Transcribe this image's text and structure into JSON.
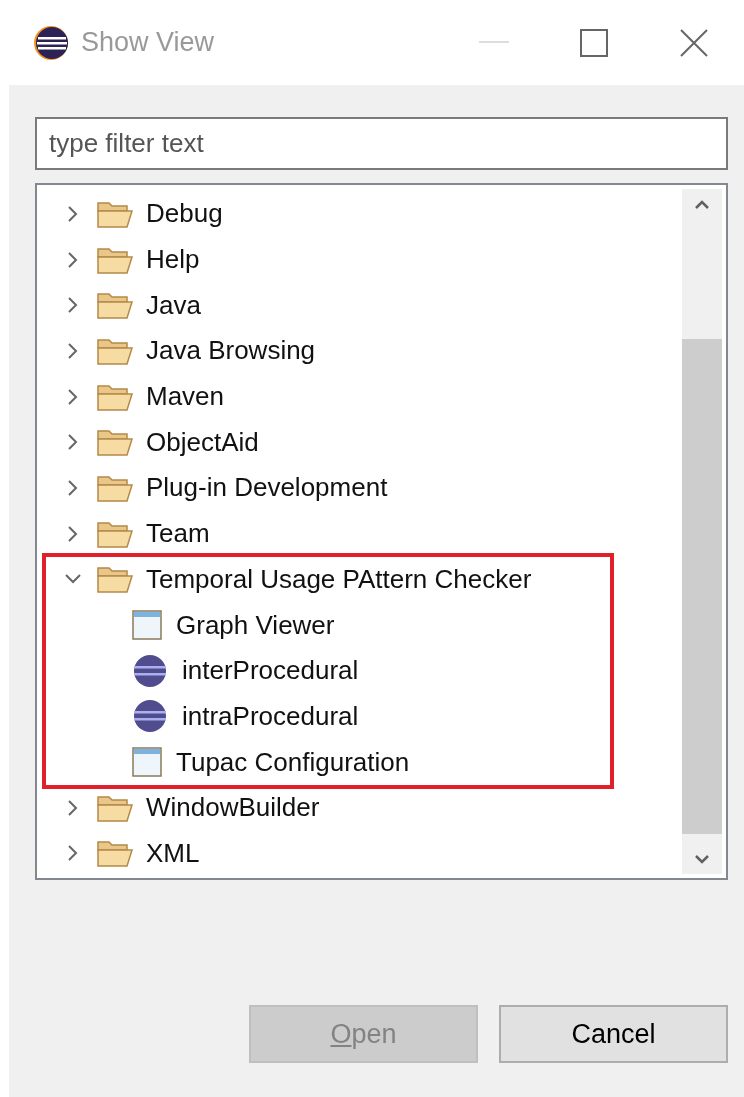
{
  "window": {
    "title": "Show View",
    "active": false
  },
  "filter": {
    "placeholder": "type filter text"
  },
  "tree": [
    {
      "label": "Debug",
      "expanded": false,
      "highlighted": false
    },
    {
      "label": "Help",
      "expanded": false,
      "highlighted": false
    },
    {
      "label": "Java",
      "expanded": false,
      "highlighted": false
    },
    {
      "label": "Java Browsing",
      "expanded": false,
      "highlighted": false
    },
    {
      "label": "Maven",
      "expanded": false,
      "highlighted": false
    },
    {
      "label": "ObjectAid",
      "expanded": false,
      "highlighted": false
    },
    {
      "label": "Plug-in Development",
      "expanded": false,
      "highlighted": false
    },
    {
      "label": "Team",
      "expanded": false,
      "highlighted": false
    },
    {
      "label": "Temporal Usage PAttern Checker",
      "expanded": true,
      "highlighted": true,
      "children": [
        {
          "label": "Graph Viewer",
          "kind": "view"
        },
        {
          "label": "interProcedural",
          "kind": "eclipse"
        },
        {
          "label": "intraProcedural",
          "kind": "eclipse"
        },
        {
          "label": "Tupac Configuration",
          "kind": "view"
        }
      ]
    },
    {
      "label": "WindowBuilder",
      "expanded": false,
      "highlighted": false
    },
    {
      "label": "XML",
      "expanded": false,
      "highlighted": false
    }
  ],
  "buttons": [
    {
      "label": "Open",
      "disabled": true,
      "mnemonic": true
    },
    {
      "label": "Cancel",
      "disabled": false,
      "mnemonic": false
    }
  ]
}
